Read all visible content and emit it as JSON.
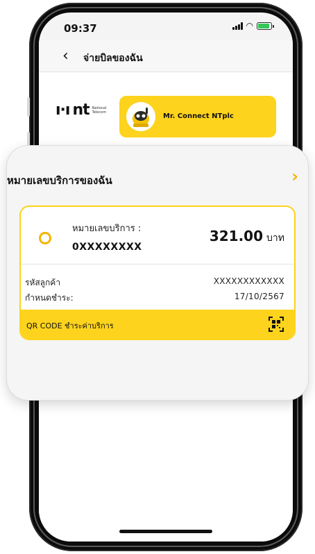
{
  "status_bar": {
    "time": "09:37"
  },
  "nav": {
    "title": "จ่ายบิลของฉัน"
  },
  "brand": {
    "logo_text": "nt",
    "logo_sub": "National Telecom"
  },
  "profile": {
    "name": "Mr. Connect NTplc"
  },
  "bill_panel": {
    "title": "หมายเลขบริการของฉัน",
    "card": {
      "service_label": "หมายเลขบริการ :",
      "service_number": "0XXXXXXXX",
      "amount": "321.00",
      "currency": "บาท",
      "customer_id_label": "รหัสลูกค้า",
      "customer_id_value": "XXXXXXXXXXXX",
      "due_label": "กำหนดชำระ:",
      "due_value": "17/10/2567",
      "qr_label": "QR CODE ชำระค่าบริการ"
    }
  },
  "colors": {
    "accent": "#fdd31d",
    "accent_dark": "#f4b400",
    "battery": "#34c759"
  },
  "icons": [
    "back-icon",
    "signal-icon",
    "wifi-icon",
    "battery-icon",
    "chevron-right-icon",
    "radio-icon",
    "qr-code-icon"
  ]
}
